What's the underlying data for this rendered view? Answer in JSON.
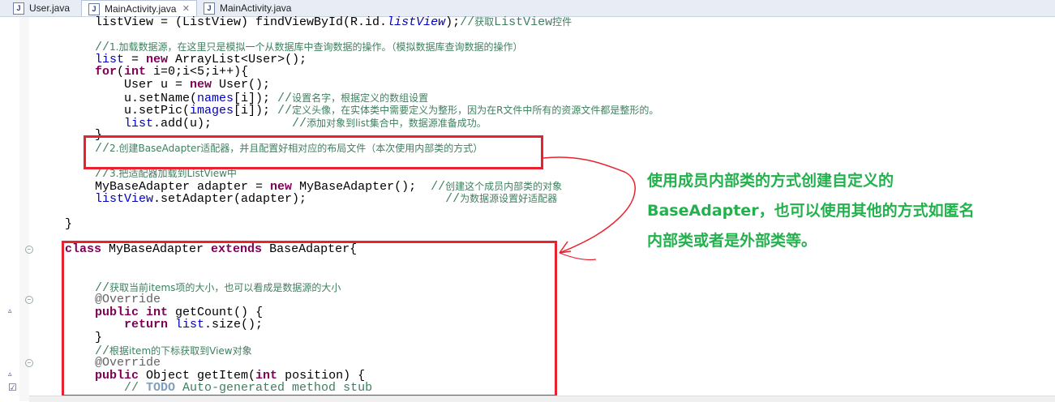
{
  "tabs": [
    {
      "label": "User.java",
      "active": false
    },
    {
      "label": "MainActivity.java",
      "active": true,
      "close": "✕"
    },
    {
      "label": "MainActivity.java",
      "active": false
    }
  ],
  "code_lines": [
    {
      "indent": 2,
      "segs": [
        [
          "",
          "listView = (ListView) findViewById(R.id."
        ],
        [
          "ital",
          "listView"
        ],
        [
          "",
          ");"
        ],
        [
          "cmm",
          "//"
        ],
        [
          "cm",
          "获取"
        ],
        [
          "cmm",
          "ListView"
        ],
        [
          "cm",
          "控件"
        ]
      ]
    },
    {
      "indent": 0,
      "segs": []
    },
    {
      "indent": 2,
      "segs": [
        [
          "cmm",
          "//"
        ],
        [
          "cm",
          "1.加载数据源，在这里只是模拟一个从数据库中查询数据的操作。（模拟数据库查询数据的操作）"
        ]
      ]
    },
    {
      "indent": 2,
      "segs": [
        [
          "fld",
          "list"
        ],
        [
          "",
          " = "
        ],
        [
          "kw",
          "new"
        ],
        [
          "",
          " ArrayList<User>();"
        ]
      ]
    },
    {
      "indent": 2,
      "segs": [
        [
          "kw",
          "for"
        ],
        [
          "",
          "("
        ],
        [
          "kw",
          "int"
        ],
        [
          "",
          " i=0;i<5;i++){"
        ]
      ]
    },
    {
      "indent": 3,
      "segs": [
        [
          "",
          "User u = "
        ],
        [
          "kw",
          "new"
        ],
        [
          "",
          " User();"
        ]
      ]
    },
    {
      "indent": 3,
      "segs": [
        [
          "",
          "u.setName("
        ],
        [
          "fld",
          "names"
        ],
        [
          "",
          "[i]); "
        ],
        [
          "cmm",
          "//"
        ],
        [
          "cm",
          "设置名字，根据定义的数组设置"
        ]
      ]
    },
    {
      "indent": 3,
      "segs": [
        [
          "",
          "u.setPic("
        ],
        [
          "fld",
          "images"
        ],
        [
          "",
          "[i]); "
        ],
        [
          "cmm",
          "//"
        ],
        [
          "cm",
          "定义头像，在实体类中需要定义为整形，因为在R文件中所有的资源文件都是整形的。"
        ]
      ]
    },
    {
      "indent": 3,
      "segs": [
        [
          "fld",
          "list"
        ],
        [
          "",
          ".add(u);           "
        ],
        [
          "cmm",
          "//"
        ],
        [
          "cm",
          "添加对象到list集合中，数据源准备成功。"
        ]
      ]
    },
    {
      "indent": 2,
      "segs": [
        [
          "",
          "}"
        ]
      ]
    },
    {
      "indent": 2,
      "segs": [
        [
          "cmm",
          "//"
        ],
        [
          "cm",
          "2.创建BaseAdapter适配器，并且配置好相对应的布局文件（本次使用内部类的方式）"
        ]
      ]
    },
    {
      "indent": 0,
      "segs": []
    },
    {
      "indent": 2,
      "segs": [
        [
          "cmm",
          "//"
        ],
        [
          "cm",
          "3.把适配器加载到ListView中"
        ]
      ]
    },
    {
      "indent": 2,
      "segs": [
        [
          "",
          "MyBaseAdapter adapter = "
        ],
        [
          "kw",
          "new"
        ],
        [
          "",
          " MyBaseAdapter();  "
        ],
        [
          "cmm",
          "//"
        ],
        [
          "cm",
          "创建这个成员内部类的对象"
        ]
      ]
    },
    {
      "indent": 2,
      "segs": [
        [
          "fld",
          "listView"
        ],
        [
          "",
          ".setAdapter(adapter);                   "
        ],
        [
          "cmm",
          "//"
        ],
        [
          "cm",
          "为数据源设置好适配器"
        ]
      ]
    },
    {
      "indent": 0,
      "segs": []
    },
    {
      "indent": 1,
      "segs": [
        [
          "",
          "}"
        ]
      ]
    },
    {
      "indent": 0,
      "segs": []
    },
    {
      "indent": 1,
      "segs": [
        [
          "kw",
          "class"
        ],
        [
          "",
          " MyBaseAdapter "
        ],
        [
          "kw",
          "extends"
        ],
        [
          "",
          " BaseAdapter{"
        ]
      ]
    },
    {
      "indent": 0,
      "segs": []
    },
    {
      "indent": 0,
      "segs": []
    },
    {
      "indent": 2,
      "segs": [
        [
          "cmm",
          "//"
        ],
        [
          "cm",
          "获取当前items项的大小，也可以看成是数据源的大小"
        ]
      ]
    },
    {
      "indent": 2,
      "segs": [
        [
          "ann",
          "@Override"
        ]
      ]
    },
    {
      "indent": 2,
      "segs": [
        [
          "kw",
          "public"
        ],
        [
          "",
          " "
        ],
        [
          "kw",
          "int"
        ],
        [
          "",
          " getCount() {"
        ]
      ]
    },
    {
      "indent": 3,
      "segs": [
        [
          "kw",
          "return"
        ],
        [
          "",
          " "
        ],
        [
          "fld",
          "list"
        ],
        [
          "",
          ".size();"
        ]
      ]
    },
    {
      "indent": 2,
      "segs": [
        [
          "",
          "}"
        ]
      ]
    },
    {
      "indent": 2,
      "segs": [
        [
          "cmm",
          "//"
        ],
        [
          "cm",
          "根据item的下标获取到View对象"
        ]
      ]
    },
    {
      "indent": 2,
      "segs": [
        [
          "ann",
          "@Override"
        ]
      ]
    },
    {
      "indent": 2,
      "segs": [
        [
          "kw",
          "public"
        ],
        [
          "",
          " Object getItem("
        ],
        [
          "kw",
          "int"
        ],
        [
          "",
          " position) {"
        ]
      ]
    },
    {
      "indent": 3,
      "segs": [
        [
          "cmm",
          "// "
        ],
        [
          "todo",
          "TODO"
        ],
        [
          "cmm",
          " Auto-generated method stub"
        ]
      ]
    }
  ],
  "annotation": {
    "lines": [
      "使用成员内部类的方式创建自定义的",
      "BaseAdapter，也可以使用其他的方式如匿名",
      "内部类或者是外部类等。"
    ]
  },
  "colors": {
    "box": "#e8222e",
    "annotation": "#22b14c"
  }
}
